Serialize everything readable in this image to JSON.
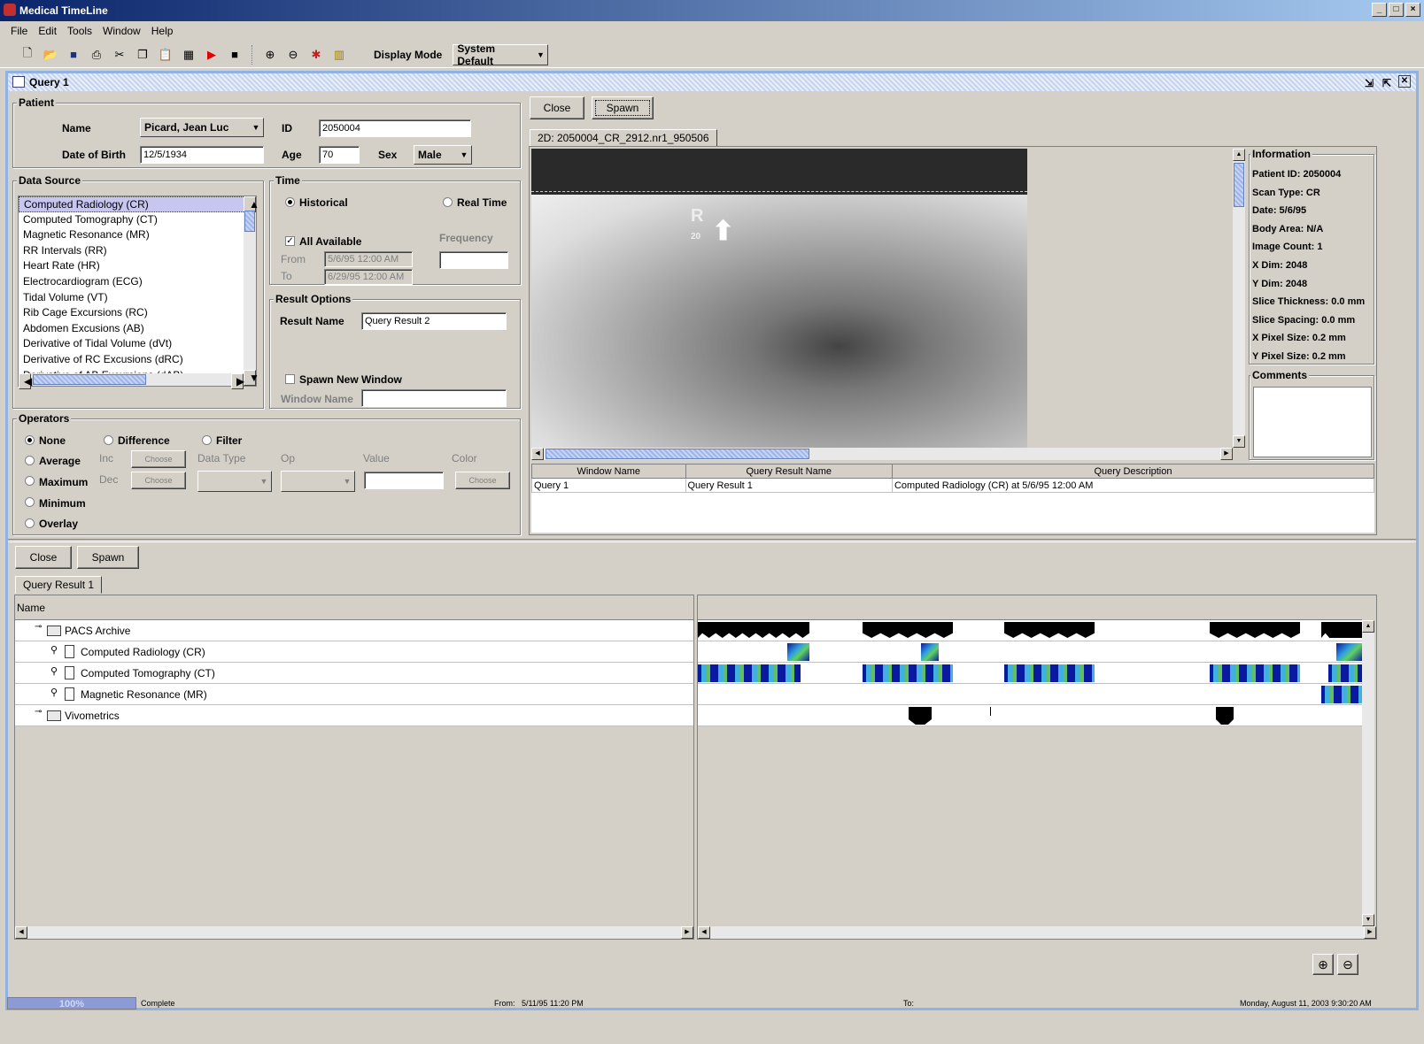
{
  "app": {
    "title": "Medical TimeLine"
  },
  "menu": [
    "File",
    "Edit",
    "Tools",
    "Window",
    "Help"
  ],
  "toolbar": {
    "display_mode_label": "Display Mode",
    "display_mode_value": "System Default"
  },
  "frame": {
    "title": "Query 1"
  },
  "patient": {
    "group": "Patient",
    "name_label": "Name",
    "name_value": "Picard, Jean Luc",
    "id_label": "ID",
    "id_value": "2050004",
    "dob_label": "Date of Birth",
    "dob_value": "12/5/1934",
    "age_label": "Age",
    "age_value": "70",
    "sex_label": "Sex",
    "sex_value": "Male"
  },
  "datasource": {
    "group": "Data Source",
    "items": [
      "Computed Radiology (CR)",
      "Computed Tomography (CT)",
      "Magnetic Resonance (MR)",
      "RR Intervals (RR)",
      "Heart Rate (HR)",
      "Electrocardiogram (ECG)",
      "Tidal Volume (VT)",
      "Rib Cage Excursions (RC)",
      "Abdomen Excusions (AB)",
      "Derivative of Tidal Volume (dVt)",
      "Derivative of RC Excusions (dRC)",
      "Derivative of AB Excursions (dAB)"
    ]
  },
  "time": {
    "group": "Time",
    "historical": "Historical",
    "realtime": "Real Time",
    "all_available": "All Available",
    "frequency": "Frequency",
    "from_label": "From",
    "from_value": "5/6/95 12:00 AM",
    "to_label": "To",
    "to_value": "6/29/95 12:00 AM"
  },
  "result": {
    "group": "Result Options",
    "name_label": "Result Name",
    "name_value": "Query Result 2",
    "spawn": "Spawn New Window",
    "window_name": "Window Name"
  },
  "operators": {
    "group": "Operators",
    "none": "None",
    "difference": "Difference",
    "filter": "Filter",
    "average": "Average",
    "maximum": "Maximum",
    "minimum": "Minimum",
    "overlay": "Overlay",
    "inc": "Inc",
    "dec": "Dec",
    "choose": "Choose",
    "data_type": "Data Type",
    "op": "Op",
    "value": "Value",
    "color": "Color"
  },
  "viewer": {
    "close": "Close",
    "spawn": "Spawn",
    "tab": "2D: 2050004_CR_2912.nr1_950506",
    "xray_marker": "R",
    "xray_marker_num": "20"
  },
  "info": {
    "group": "Information",
    "lines": [
      "Patient ID: 2050004",
      "Scan Type: CR",
      "Date: 5/6/95",
      "Body Area: N/A",
      "Image Count: 1",
      "X Dim: 2048",
      "Y Dim: 2048",
      "Slice Thickness: 0.0 mm",
      "Slice Spacing: 0.0 mm",
      "X Pixel Size: 0.2 mm",
      "Y Pixel Size: 0.2 mm"
    ],
    "comments": "Comments"
  },
  "results_table": {
    "headers": [
      "Window Name",
      "Query Result Name",
      "Query Description"
    ],
    "rows": [
      [
        "Query 1",
        "Query Result 1",
        "Computed Radiology (CR) at 5/6/95 12:00 AM"
      ]
    ]
  },
  "bottom": {
    "close": "Close",
    "spawn": "Spawn",
    "tab": "Query Result 1",
    "name_header": "Name",
    "tree": [
      "PACS Archive",
      "Computed Radiology (CR)",
      "Computed Tomography (CT)",
      "Magnetic Resonance (MR)",
      "Vivometrics"
    ]
  },
  "status": {
    "progress": 1.0,
    "progress_text": "100%",
    "state": "Complete",
    "from": "From:   5/11/95 11:20 PM",
    "to": "To:",
    "datetime": "Monday, August 11, 2003 9:30:20 AM"
  }
}
